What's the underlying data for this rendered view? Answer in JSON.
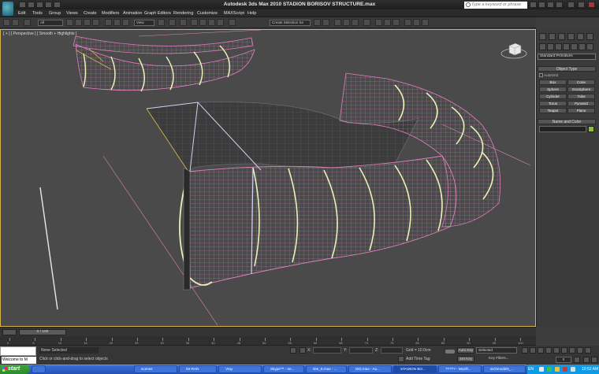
{
  "window": {
    "title": "Autodesk 3ds Max 2010      STADION BORISOV STRUCTURE.max",
    "search_placeholder": "Type a keyword or phrase"
  },
  "menu": [
    "Edit",
    "Tools",
    "Group",
    "Views",
    "Create",
    "Modifiers",
    "Animation",
    "Graph Editors",
    "Rendering",
    "Customize",
    "MAXScript",
    "Help"
  ],
  "toolbar": {
    "selection_filter": "All",
    "reference_coord": "View",
    "named_selection": "Create Selection Se"
  },
  "viewport": {
    "label": "[ + ] [ Perspective ] [ Smooth + Highlights ]",
    "border_color": "#d6b44a",
    "structure_color": "#e27fc0",
    "rib_color": "#e9f0b8"
  },
  "command_panel": {
    "category": "Standard Primitives",
    "object_type_title": "Object Type",
    "autogrid_label": "AutoGrid",
    "primitives": [
      "Box",
      "Cone",
      "Sphere",
      "GeoSphere",
      "Cylinder",
      "Tube",
      "Torus",
      "Pyramid",
      "Teapot",
      "Plane"
    ],
    "name_color_title": "Name and Color",
    "swatch_color": "#8bbf3a"
  },
  "timeline": {
    "slider_label": "0 / 100",
    "ticks": [
      "0",
      "5",
      "10",
      "15",
      "20",
      "25",
      "30",
      "35",
      "40",
      "45",
      "50",
      "55",
      "60",
      "65",
      "70",
      "75",
      "80",
      "85",
      "90",
      "95",
      "100"
    ]
  },
  "status": {
    "maxscript_text": "Welcome to M",
    "selection": "None Selected",
    "prompt": "Click or click-and-drag to select objects",
    "x_label": "X:",
    "y_label": "Y:",
    "z_label": "Z:",
    "grid": "Grid = 10.0cm",
    "add_time_tag": "Add Time Tag",
    "auto_key": "Auto Key",
    "set_key": "Set Key",
    "key_mode": "Selected",
    "key_filters": "Key Filters...",
    "frame": "0"
  },
  "taskbar": {
    "start": "start",
    "tasks": [
      "scenes",
      "03-RAN",
      "Vray",
      "Skype™ - ne...",
      "site_E.max - ...",
      "002.max - Au...",
      "STADION BO...",
      "????? - Mozill...",
      "archmodels_..."
    ],
    "lang": "EN",
    "clock": "10:52 AM"
  }
}
